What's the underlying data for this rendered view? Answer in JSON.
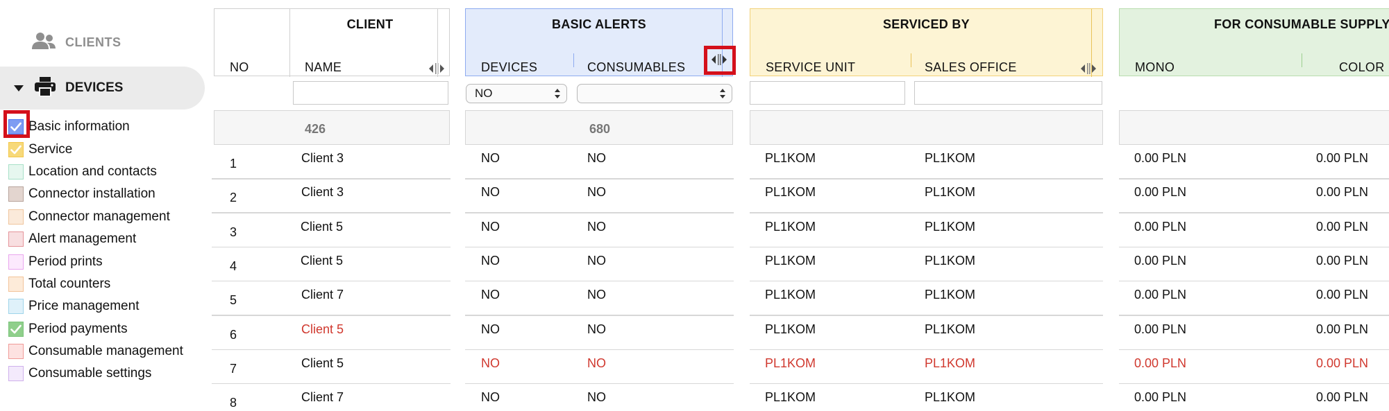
{
  "sidebar": {
    "clients_label": "CLIENTS",
    "devices_label": "DEVICES",
    "categories": [
      {
        "label": "Basic information",
        "color": "#4a76f0",
        "fill": "#7e9cf2",
        "checked": true
      },
      {
        "label": "Service",
        "color": "#f3c74a",
        "fill": "#f7d97a",
        "checked": true
      },
      {
        "label": "Location and contacts",
        "color": "#a8e0c8",
        "fill": "#e6f7ef",
        "checked": false
      },
      {
        "label": "Connector installation",
        "color": "#b8a49c",
        "fill": "#e3d5cf",
        "checked": false
      },
      {
        "label": "Connector management",
        "color": "#efc59d",
        "fill": "#fbeada",
        "checked": false
      },
      {
        "label": "Alert management",
        "color": "#e5949a",
        "fill": "#f8dfe1",
        "checked": false
      },
      {
        "label": "Period prints",
        "color": "#e9a6ee",
        "fill": "#fce9fd",
        "checked": false
      },
      {
        "label": "Total counters",
        "color": "#f2c49a",
        "fill": "#fdebd9",
        "checked": false
      },
      {
        "label": "Price management",
        "color": "#9fd4ea",
        "fill": "#dff1fa",
        "checked": false
      },
      {
        "label": "Period payments",
        "color": "#7cc47c",
        "fill": "#8fcf8b",
        "checked": true
      },
      {
        "label": "Consumable management",
        "color": "#f09b98",
        "fill": "#fde2e1",
        "checked": false
      },
      {
        "label": "Consumable settings",
        "color": "#cfb1ec",
        "fill": "#f3eafc",
        "checked": false
      }
    ]
  },
  "groups": {
    "client": {
      "title": "CLIENT",
      "col_no": "NO",
      "col_name": "NAME",
      "sum": "426"
    },
    "alerts": {
      "title": "BASIC ALERTS",
      "col_devices": "DEVICES",
      "col_consumables": "CONSUMABLES",
      "devices_filter": "NO",
      "sum": "680",
      "bg": "#e3ebfb",
      "border": "#8eabf0"
    },
    "serviced": {
      "title": "SERVICED BY",
      "col_unit": "SERVICE UNIT",
      "col_office": "SALES OFFICE",
      "bg": "#fdf4d4",
      "border": "#f2d27a"
    },
    "supply": {
      "title": "FOR CONSUMABLE SUPPLY",
      "col_mono": "MONO",
      "col_color": "COLOR",
      "bg": "#e3f2df",
      "border": "#b8dcae"
    }
  },
  "colors": {
    "accent_red": "#d4101b",
    "text_red": "#d0382e"
  },
  "rows": [
    {
      "no": "1",
      "name": "Client 3",
      "devices": "NO",
      "consumables": "NO",
      "unit": "PL1KOM",
      "office": "PL1KOM",
      "mono": "0.00 PLN",
      "color": "0.00 PLN",
      "name_red": false,
      "rest_red": false
    },
    {
      "no": "2",
      "name": "Client 3",
      "devices": "NO",
      "consumables": "NO",
      "unit": "PL1KOM",
      "office": "PL1KOM",
      "mono": "0.00 PLN",
      "color": "0.00 PLN",
      "name_red": false,
      "rest_red": false
    },
    {
      "no": "3",
      "name": "Client 5",
      "devices": "NO",
      "consumables": "NO",
      "unit": "PL1KOM",
      "office": "PL1KOM",
      "mono": "0.00 PLN",
      "color": "0.00 PLN",
      "name_red": false,
      "rest_red": false
    },
    {
      "no": "4",
      "name": "Client 5",
      "devices": "NO",
      "consumables": "NO",
      "unit": "PL1KOM",
      "office": "PL1KOM",
      "mono": "0.00 PLN",
      "color": "0.00 PLN",
      "name_red": false,
      "rest_red": false
    },
    {
      "no": "5",
      "name": "Client 7",
      "devices": "NO",
      "consumables": "NO",
      "unit": "PL1KOM",
      "office": "PL1KOM",
      "mono": "0.00 PLN",
      "color": "0.00 PLN",
      "name_red": false,
      "rest_red": false
    },
    {
      "no": "6",
      "name": "Client 5",
      "devices": "NO",
      "consumables": "NO",
      "unit": "PL1KOM",
      "office": "PL1KOM",
      "mono": "0.00 PLN",
      "color": "0.00 PLN",
      "name_red": true,
      "rest_red": false
    },
    {
      "no": "7",
      "name": "Client 5",
      "devices": "NO",
      "consumables": "NO",
      "unit": "PL1KOM",
      "office": "PL1KOM",
      "mono": "0.00 PLN",
      "color": "0.00 PLN",
      "name_red": false,
      "rest_red": true
    },
    {
      "no": "8",
      "name": "Client 7",
      "devices": "NO",
      "consumables": "NO",
      "unit": "PL1KOM",
      "office": "PL1KOM",
      "mono": "0.00 PLN",
      "color": "0.00 PLN",
      "name_red": false,
      "rest_red": false
    }
  ]
}
